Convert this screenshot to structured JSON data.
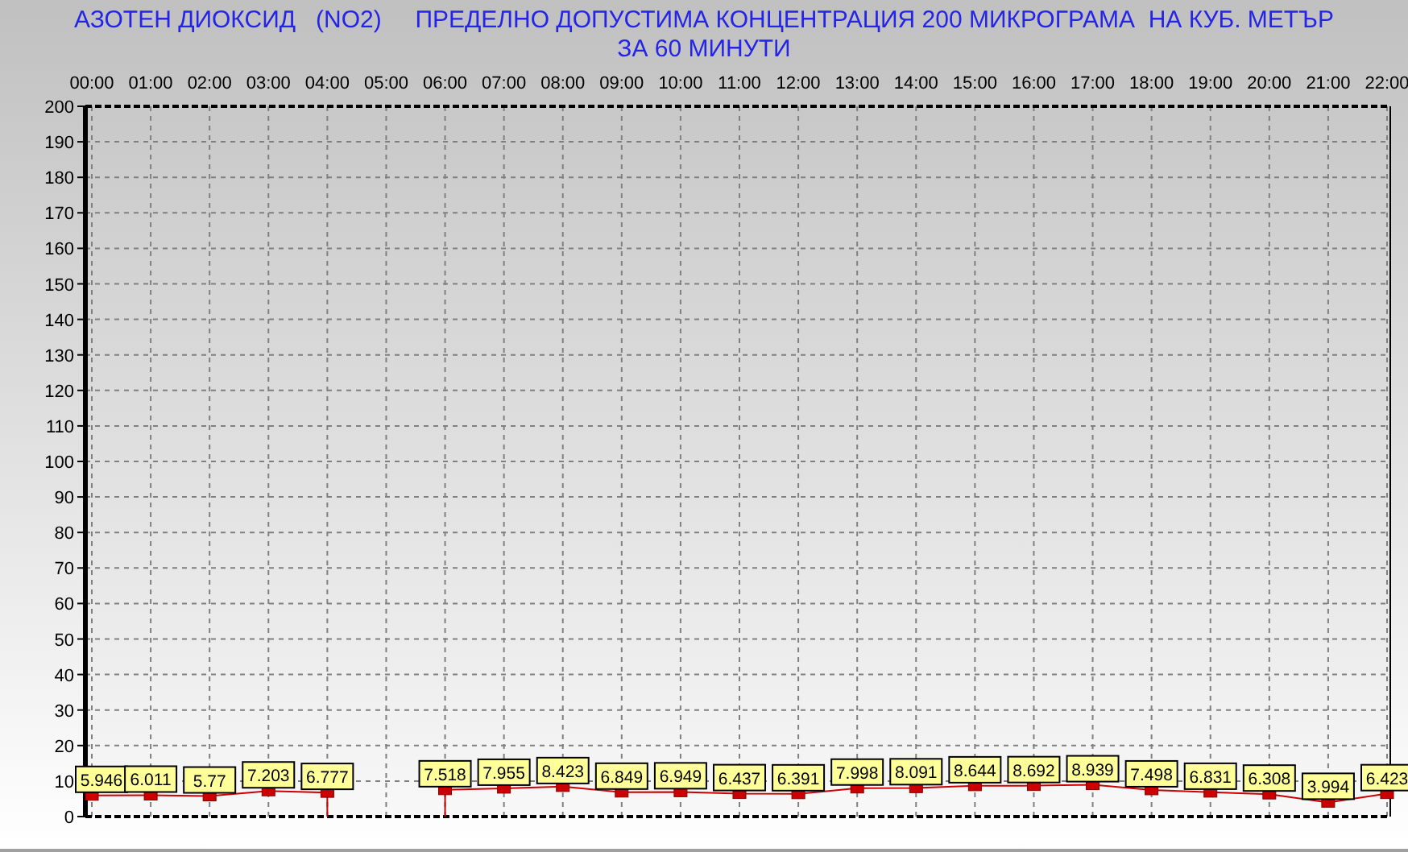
{
  "chart_data": {
    "type": "line",
    "title": "АЗОТЕН ДИОКСИД   (NO2)     ПРЕДЕЛНО ДОПУСТИМА КОНЦЕНТРАЦИЯ 200 МИКРОГРАМА  НА КУБ. МЕТЪР ЗА 60 МИНУТИ",
    "categories": [
      "00:00",
      "01:00",
      "02:00",
      "03:00",
      "04:00",
      "05:00",
      "06:00",
      "07:00",
      "08:00",
      "09:00",
      "10:00",
      "11:00",
      "12:00",
      "13:00",
      "14:00",
      "15:00",
      "16:00",
      "17:00",
      "18:00",
      "19:00",
      "20:00",
      "21:00",
      "22:00"
    ],
    "grid": true,
    "series": [
      {
        "color": "#cc0000",
        "marker": "square",
        "values": [
          5.946,
          6.011,
          5.77,
          7.203,
          6.777,
          null,
          7.518,
          7.955,
          8.423,
          6.849,
          6.949,
          6.437,
          6.391,
          7.998,
          8.091,
          8.644,
          8.692,
          8.939,
          7.498,
          6.831,
          6.308,
          3.994,
          6.423
        ]
      }
    ],
    "value_labels": [
      "5.946",
      "6.011",
      "5.77",
      "7.203",
      "6.777",
      null,
      "7.518",
      "7.955",
      "8.423",
      "6.849",
      "6.949",
      "6.437",
      "6.391",
      "7.998",
      "8.091",
      "8.644",
      "8.692",
      "8.939",
      "7.498",
      "6.831",
      "6.308",
      "3.994",
      "6.423"
    ],
    "ylim": [
      0,
      200
    ],
    "yticks": [
      0,
      10,
      20,
      30,
      40,
      50,
      60,
      70,
      80,
      90,
      100,
      110,
      120,
      130,
      140,
      150,
      160,
      170,
      180,
      190,
      200
    ]
  }
}
